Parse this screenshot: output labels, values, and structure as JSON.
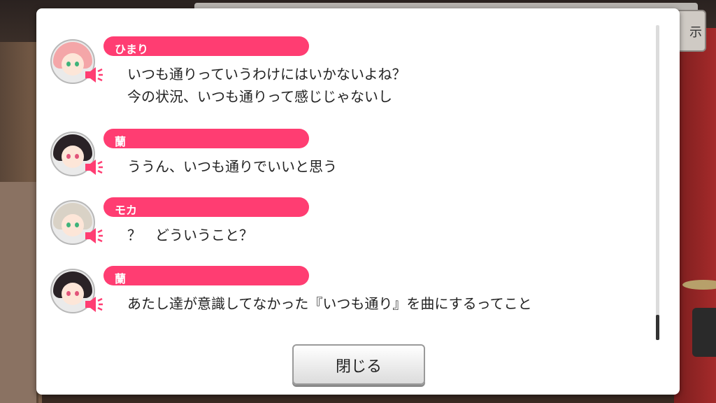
{
  "dialog": {
    "entries": [
      {
        "name": "ひまり",
        "lines": [
          "いつも通りっていうわけにはいかないよね？",
          "今の状況、いつも通りって感じじゃないし"
        ],
        "avatar_colors": {
          "hair": "#f4a6a8",
          "eye": "#3fb37a"
        }
      },
      {
        "name": "蘭",
        "lines": [
          "ううん、いつも通りでいいと思う"
        ],
        "avatar_colors": {
          "hair": "#2a2226",
          "eye": "#e2547a"
        }
      },
      {
        "name": "モカ",
        "lines": [
          "？　どういうこと？"
        ],
        "avatar_colors": {
          "hair": "#d9d2c6",
          "eye": "#3fb37a"
        }
      },
      {
        "name": "蘭",
        "lines": [
          "あたし達が意識してなかった『いつも通り』を曲にするってこと"
        ],
        "avatar_colors": {
          "hair": "#2a2226",
          "eye": "#e2547a"
        }
      }
    ],
    "close_label": "閉じる"
  },
  "colors": {
    "name_pill": "#ff3d72",
    "speaker_icon": "#ff3d72"
  },
  "background": {
    "side_button_glyph": "示"
  }
}
